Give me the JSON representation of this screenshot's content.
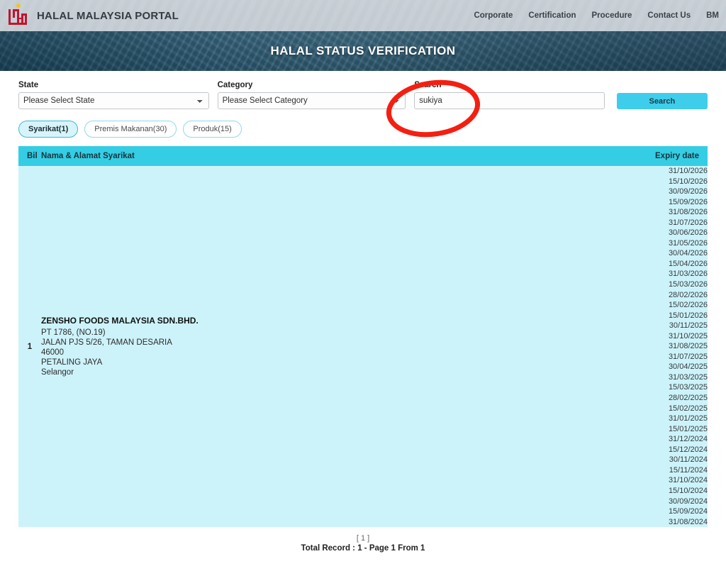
{
  "header": {
    "logo_icon": "halal-logo-icon",
    "brand_title": "HALAL MALAYSIA PORTAL",
    "nav": [
      {
        "label": "Corporate"
      },
      {
        "label": "Certification"
      },
      {
        "label": "Procedure"
      },
      {
        "label": "Contact Us"
      },
      {
        "label": "BM"
      }
    ]
  },
  "hero": {
    "title": "HALAL STATUS VERIFICATION"
  },
  "filters": {
    "state": {
      "label": "State",
      "selected": "Please Select State",
      "options": [
        "Please Select State"
      ]
    },
    "category": {
      "label": "Category",
      "selected": "Please Select Category",
      "options": [
        "Please Select Category"
      ]
    },
    "search": {
      "label": "Search",
      "value": "sukiya",
      "placeholder": ""
    },
    "search_button": "Search"
  },
  "tabs": [
    {
      "label": "Syarikat(1)",
      "active": true
    },
    {
      "label": "Premis Makanan(30)",
      "active": false
    },
    {
      "label": "Produk(15)",
      "active": false
    }
  ],
  "table": {
    "columns": {
      "bil": "Bil",
      "name": "Nama & Alamat Syarikat",
      "expiry": "Expiry date"
    },
    "rows": [
      {
        "bil": "1",
        "company_name": "ZENSHO FOODS MALAYSIA SDN.BHD.",
        "address": [
          "PT 1786, (NO.19)",
          "JALAN PJS 5/26, TAMAN DESARIA",
          "46000",
          "PETALING JAYA",
          "Selangor"
        ],
        "expiry_dates": [
          "31/10/2026",
          "15/10/2026",
          "30/09/2026",
          "15/09/2026",
          "31/08/2026",
          "31/07/2026",
          "30/06/2026",
          "31/05/2026",
          "30/04/2026",
          "15/04/2026",
          "31/03/2026",
          "15/03/2026",
          "28/02/2026",
          "15/02/2026",
          "15/01/2026",
          "30/11/2025",
          "31/10/2025",
          "31/08/2025",
          "31/07/2025",
          "30/04/2025",
          "31/03/2025",
          "15/03/2025",
          "28/02/2025",
          "15/02/2025",
          "31/01/2025",
          "15/01/2025",
          "31/12/2024",
          "15/12/2024",
          "30/11/2024",
          "15/11/2024",
          "31/10/2024",
          "15/10/2024",
          "30/09/2024",
          "15/09/2024",
          "31/08/2024"
        ]
      }
    ]
  },
  "pagination": {
    "pages": "[ 1 ]",
    "total": "Total Record : 1 - Page 1 From 1"
  },
  "annotation": {
    "shape": "ellipse-highlight",
    "color": "#f41f11"
  },
  "colors": {
    "table_header": "#35cde4",
    "table_body": "#cdf3fa",
    "button": "#3ecdeb",
    "annotation": "#f41f11"
  }
}
